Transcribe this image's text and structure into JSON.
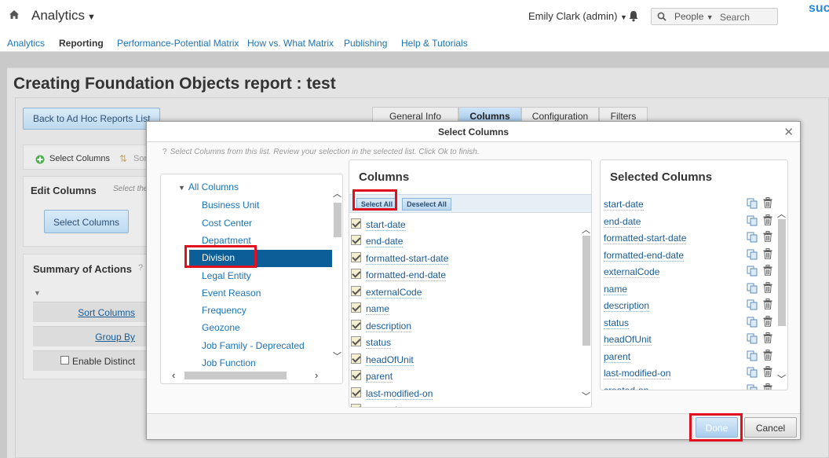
{
  "header": {
    "app_title": "Analytics",
    "user": "Emily Clark (admin)",
    "search_scope": "People",
    "search_placeholder": "Search",
    "brand": "suc"
  },
  "nav": {
    "items": [
      {
        "label": "Analytics"
      },
      {
        "label": "Reporting"
      },
      {
        "label": "Performance-Potential Matrix"
      },
      {
        "label": "How vs. What Matrix"
      },
      {
        "label": "Publishing"
      },
      {
        "label": "Help & Tutorials"
      }
    ],
    "active": "Reporting"
  },
  "page": {
    "title": "Creating Foundation Objects report : test",
    "back_button": "Back to Ad Hoc Reports List",
    "tabs": [
      {
        "label": "General Info"
      },
      {
        "label": "Columns"
      },
      {
        "label": "Configuration"
      },
      {
        "label": "Filters"
      }
    ],
    "active_tab": "Columns",
    "toolbar": {
      "select_columns": "Select Columns",
      "sort_partial": "Sor"
    },
    "edit_columns": {
      "title": "Edit Columns",
      "hint": "Select the",
      "button": "Select Columns"
    },
    "summary": {
      "title": "Summary of Actions",
      "sort_columns": "Sort Columns",
      "group_by": "Group By",
      "enable_distinct": "Enable Distinct"
    }
  },
  "modal": {
    "title": "Select Columns",
    "instructions": "Select Columns from this list. Review your selection in the selected list. Click Ok to finish.",
    "tree": {
      "root": "All Columns",
      "items": [
        {
          "label": "Business Unit"
        },
        {
          "label": "Cost Center"
        },
        {
          "label": "Department"
        },
        {
          "label": "Division"
        },
        {
          "label": "Legal Entity"
        },
        {
          "label": "Event Reason"
        },
        {
          "label": "Frequency"
        },
        {
          "label": "Geozone"
        },
        {
          "label": "Job Family - Deprecated"
        },
        {
          "label": "Job Function"
        }
      ],
      "selected": "Division"
    },
    "columns": {
      "title": "Columns",
      "select_all": "Select All",
      "deselect_all": "Deselect All",
      "items": [
        {
          "label": "start-date",
          "checked": true
        },
        {
          "label": "end-date",
          "checked": true
        },
        {
          "label": "formatted-start-date",
          "checked": true
        },
        {
          "label": "formatted-end-date",
          "checked": true
        },
        {
          "label": "externalCode",
          "checked": true
        },
        {
          "label": "name",
          "checked": true
        },
        {
          "label": "description",
          "checked": true
        },
        {
          "label": "status",
          "checked": true
        },
        {
          "label": "headOfUnit",
          "checked": true
        },
        {
          "label": "parent",
          "checked": true
        },
        {
          "label": "last-modified-on",
          "checked": true
        },
        {
          "label": "created-on",
          "checked": true
        }
      ]
    },
    "selected_columns": {
      "title": "Selected Columns",
      "items": [
        {
          "label": "start-date"
        },
        {
          "label": "end-date"
        },
        {
          "label": "formatted-start-date"
        },
        {
          "label": "formatted-end-date"
        },
        {
          "label": "externalCode"
        },
        {
          "label": "name"
        },
        {
          "label": "description"
        },
        {
          "label": "status"
        },
        {
          "label": "headOfUnit"
        },
        {
          "label": "parent"
        },
        {
          "label": "last-modified-on"
        },
        {
          "label": "created-on"
        }
      ]
    },
    "done": "Done",
    "cancel": "Cancel"
  },
  "colors": {
    "link": "#1a73b8",
    "selected_tree_bg": "#0b5e97",
    "highlight": "#e0101e"
  }
}
